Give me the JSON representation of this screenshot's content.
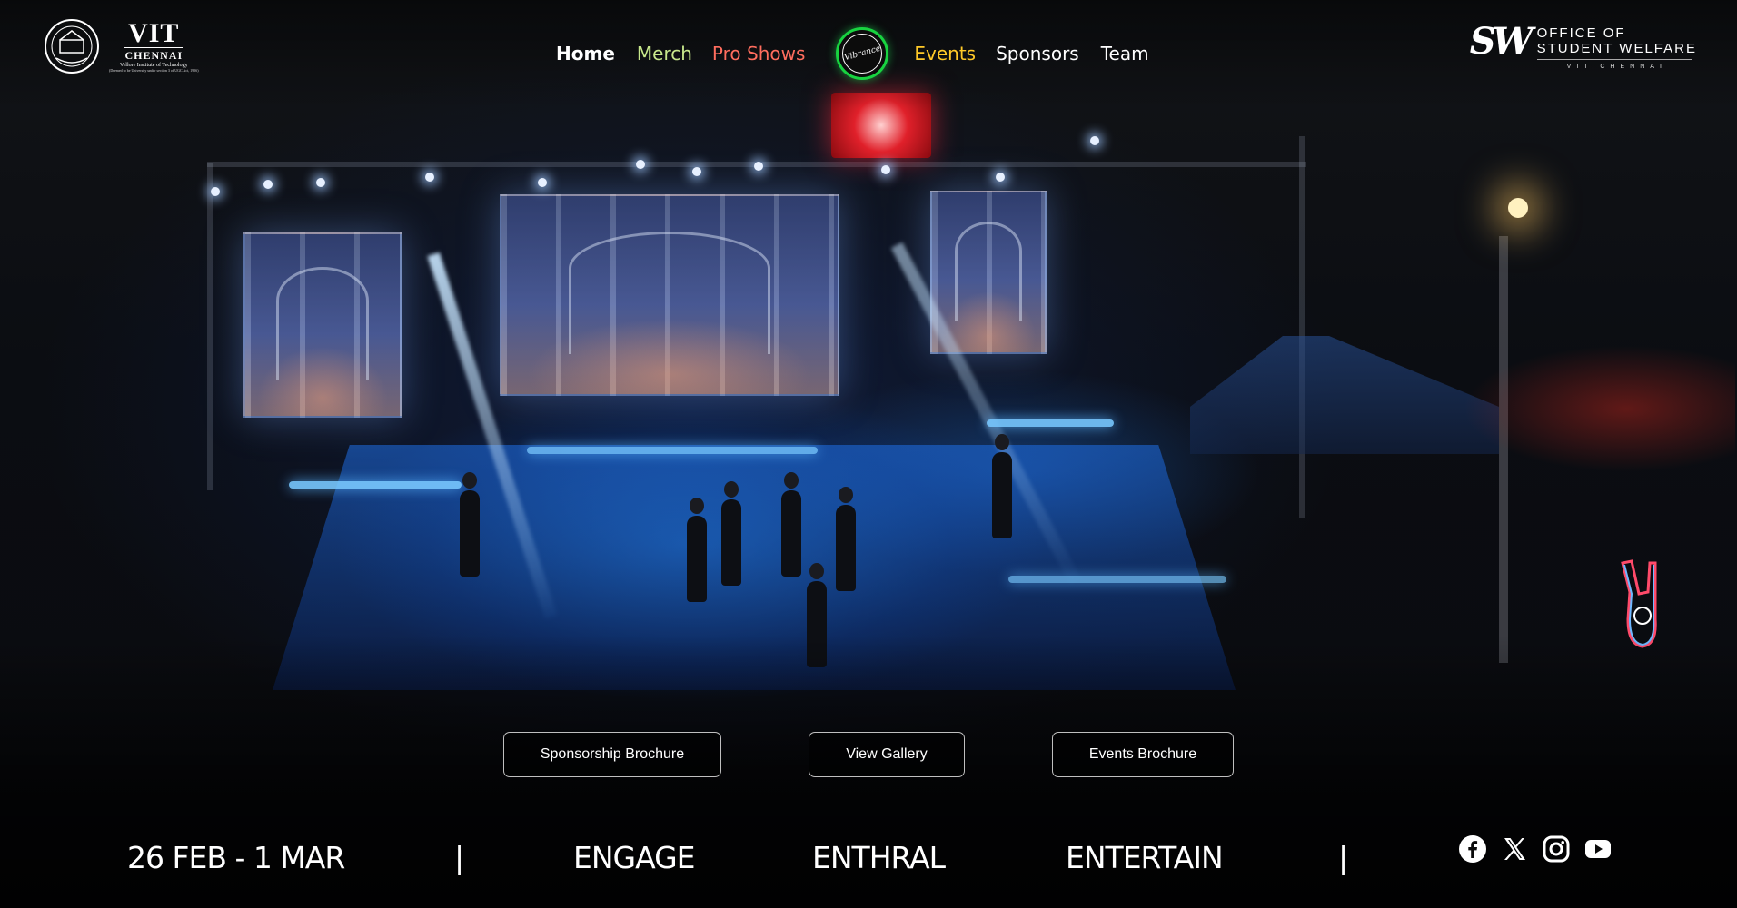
{
  "brand": {
    "left_logo": {
      "title": "VIT",
      "city": "CHENNAI",
      "subtitle": "Vellore Institute of Technology",
      "tagline": "(Deemed to be University under section 3 of UGC Act, 1956)"
    },
    "center_badge": {
      "text": "Vibrance"
    },
    "right_logo": {
      "mark": "SW",
      "line1": "OFFICE OF",
      "line2": "STUDENT WELFARE",
      "sub": "VIT CHENNAI"
    }
  },
  "nav": {
    "home": "Home",
    "merch": "Merch",
    "pro_shows": "Pro Shows",
    "events": "Events",
    "sponsors": "Sponsors",
    "team": "Team"
  },
  "nav_colors": {
    "home": "#ffffff",
    "merch": "#c8e88c",
    "pro_shows": "#ff6d5e",
    "events": "#ffc928",
    "sponsors": "#ffffff",
    "team": "#ffffff",
    "badge_ring": "#18d340"
  },
  "actions": {
    "sponsorship": "Sponsorship Brochure",
    "gallery": "View Gallery",
    "events_brochure": "Events Brochure"
  },
  "strip": {
    "dates": "26 FEB - 1 MAR",
    "separator": "|",
    "word1": "ENGAGE",
    "word2": "ENTHRAL",
    "word3": "ENTERTAIN"
  },
  "social": [
    "facebook-icon",
    "x-icon",
    "instagram-icon",
    "youtube-icon"
  ]
}
